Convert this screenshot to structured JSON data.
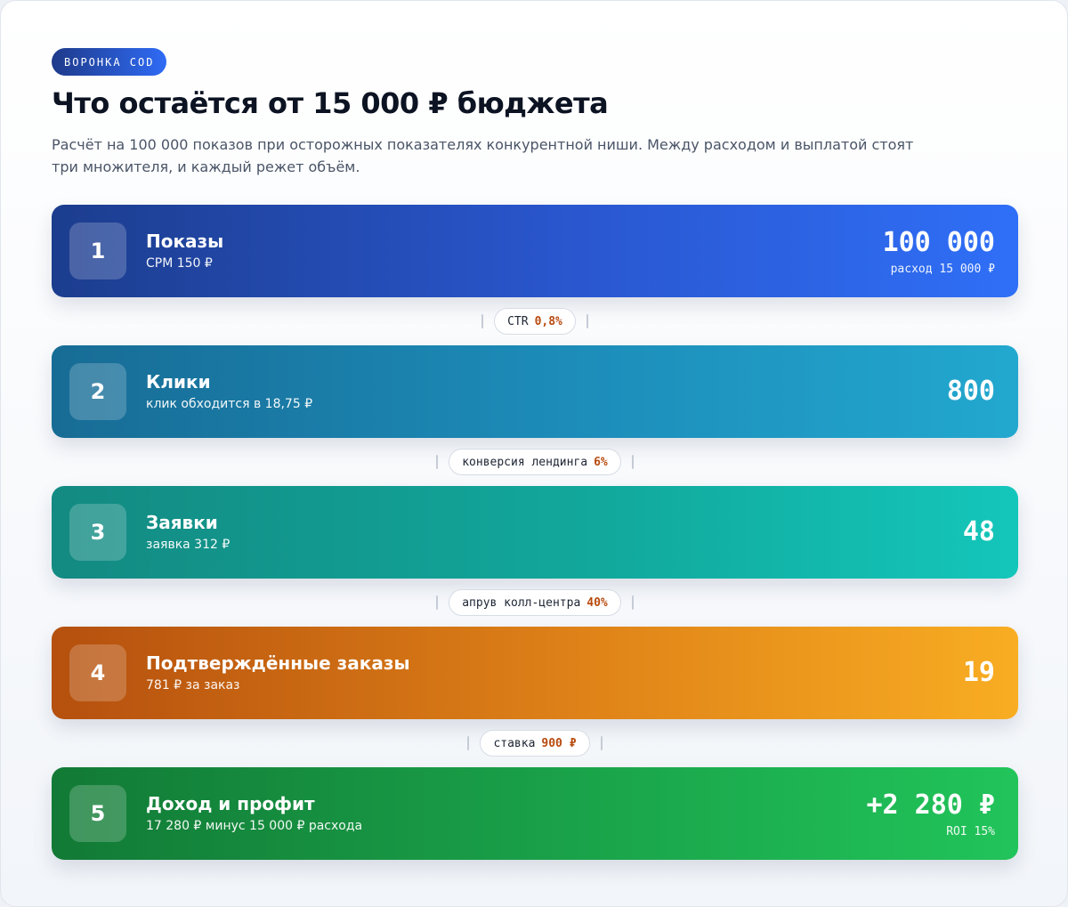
{
  "badge": "ВОРОНКА COD",
  "title": "Что остаётся от 15 000 ₽ бюджета",
  "subtitle": "Расчёт на 100 000 показов при осторожных показателях конкурентной ниши. Между расходом и выплатой стоят три множителя, и каждый режет объём.",
  "stages": [
    {
      "number": "1",
      "label": "Показы",
      "note": "CPM 150 ₽",
      "value": "100 000",
      "sub": "расход 15 000 ₽"
    },
    {
      "number": "2",
      "label": "Клики",
      "note": "клик обходится в 18,75 ₽",
      "value": "800",
      "sub": ""
    },
    {
      "number": "3",
      "label": "Заявки",
      "note": "заявка 312 ₽",
      "value": "48",
      "sub": ""
    },
    {
      "number": "4",
      "label": "Подтверждённые заказы",
      "note": "781 ₽ за заказ",
      "value": "19",
      "sub": ""
    },
    {
      "number": "5",
      "label": "Доход и профит",
      "note": "17 280 ₽ минус 15 000 ₽ расхода",
      "value": "+2 280 ₽",
      "sub": "ROI 15%"
    }
  ],
  "connectors": [
    {
      "label": "CTR",
      "rate": "0,8%"
    },
    {
      "label": "конверсия лендинга",
      "rate": "6%"
    },
    {
      "label": "апрув колл-центра",
      "rate": "40%"
    },
    {
      "label": "ставка",
      "rate": "900 ₽"
    }
  ],
  "colors": {
    "accent_blue": "#2f6ff7",
    "rate_text": "#b84a0f",
    "stage_1": "#2a57d0",
    "stage_2": "#1d8dba",
    "stage_3": "#12a79b",
    "stage_4": "#df8218",
    "stage_5": "#1aa34a"
  }
}
